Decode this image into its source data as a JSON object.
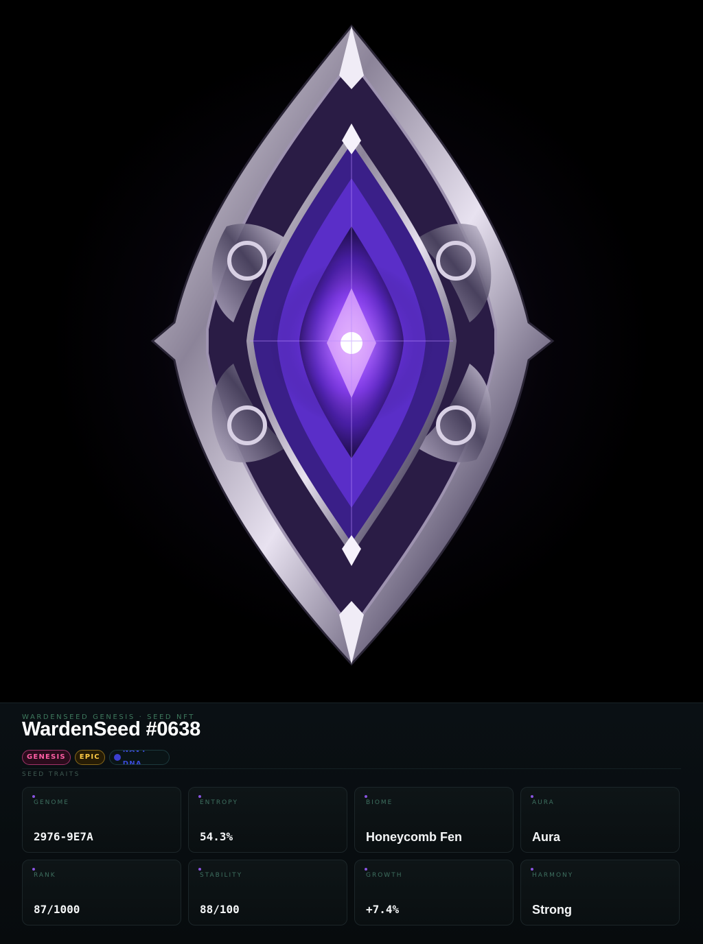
{
  "artwork": {
    "icon": "crystal-seed-gem",
    "accent": "#8b45ff",
    "frame": "#c9c2d4"
  },
  "header": {
    "eyebrow": "WARDENSEED GENESIS · SEED NFT",
    "title": "WardenSeed #0638"
  },
  "tags": {
    "genesis": "GENESIS",
    "epic": "EPIC",
    "dna": "NAVY DNA"
  },
  "traits": {
    "section_label": "SEED TRAITS",
    "items": [
      {
        "label": "GENOME",
        "value": "2976-9E7A"
      },
      {
        "label": "ENTROPY",
        "value": "54.3%"
      },
      {
        "label": "BIOME",
        "value": "Honeycomb Fen"
      },
      {
        "label": "AURA",
        "value": "Aura"
      },
      {
        "label": "RANK",
        "value": "87/1000"
      },
      {
        "label": "STABILITY",
        "value": "88/100"
      },
      {
        "label": "GROWTH",
        "value": "+7.4%"
      },
      {
        "label": "HARMONY",
        "value": "Strong"
      }
    ]
  },
  "colors": {
    "genesis": "#ff5fa5",
    "epic": "#ffcb45",
    "dna": "#3c3fd0",
    "trait_bullet": "#8a54e0"
  }
}
